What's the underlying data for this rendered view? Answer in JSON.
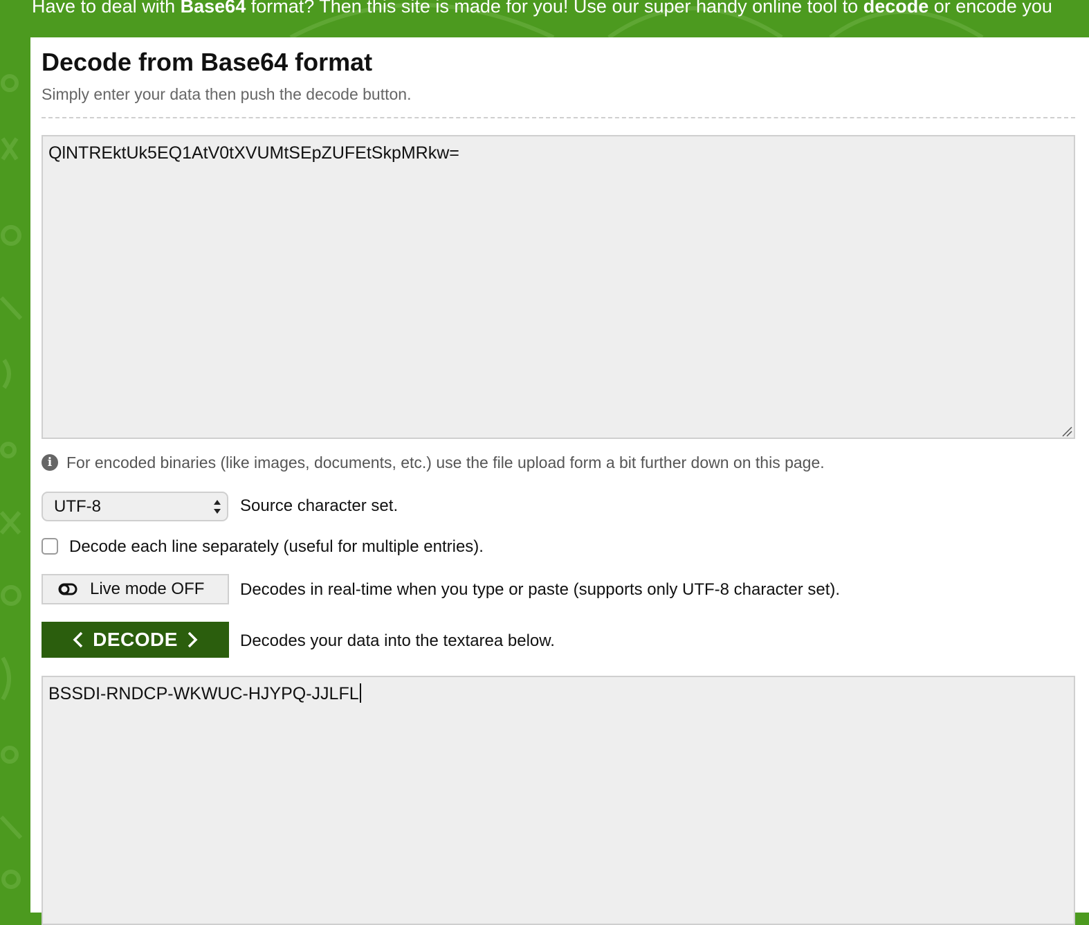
{
  "banner": {
    "part1": "Have to deal with ",
    "bold1": "Base64",
    "part2": " format? Then this site is made for you! Use our super handy online tool to ",
    "bold2": "decode",
    "part3": " or encode you"
  },
  "page": {
    "title": "Decode from Base64 format",
    "subtitle": "Simply enter your data then push the decode button."
  },
  "input": {
    "value": "QlNTREktUk5EQ1AtV0tXVUMtSEpZUFEtSkpMRkw="
  },
  "info": {
    "text": "For encoded binaries (like images, documents, etc.) use the file upload form a bit further down on this page.",
    "icon": "info-icon"
  },
  "charset": {
    "selected": "UTF-8",
    "label": "Source character set."
  },
  "separate_lines": {
    "checked": false,
    "label": "Decode each line separately (useful for multiple entries)."
  },
  "live_mode": {
    "button_label": "Live mode OFF",
    "description": "Decodes in real-time when you type or paste (supports only UTF-8 character set)."
  },
  "decode": {
    "button_label": "DECODE",
    "description": "Decodes your data into the textarea below."
  },
  "output": {
    "value": "BSSDI-RNDCP-WKWUC-HJYPQ-JJLFL"
  },
  "colors": {
    "brand_green": "#4c9a1f",
    "decode_button": "#2b5e0d",
    "textarea_bg": "#eeeeee"
  }
}
